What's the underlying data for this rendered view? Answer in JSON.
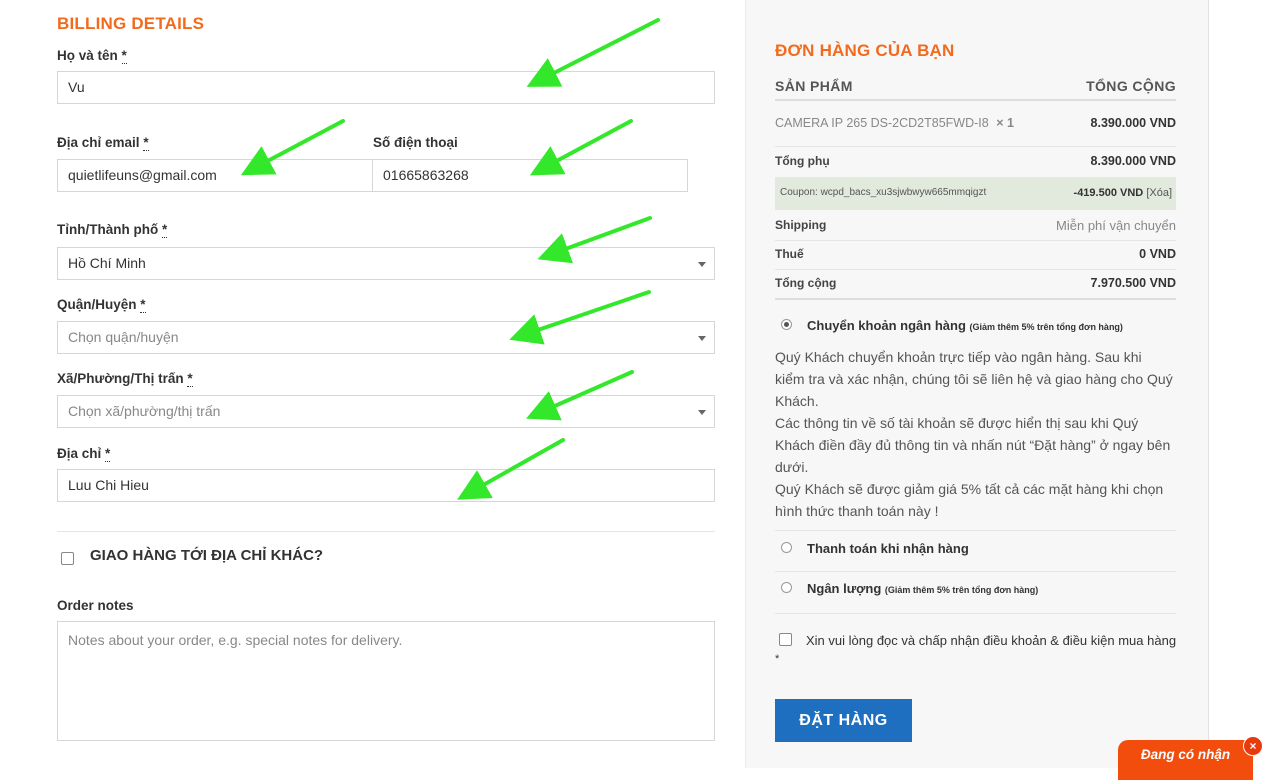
{
  "billing": {
    "title": "BILLING DETAILS",
    "fullname_label": "Họ và tên",
    "fullname_value": "Vu",
    "email_label": "Địa chỉ email",
    "email_value": "quietlifeuns@gmail.com",
    "phone_label": "Số điện thoại",
    "phone_value": "01665863268",
    "province_label": "Tỉnh/Thành phố",
    "province_value": "Hồ Chí Minh",
    "district_label": "Quận/Huyện",
    "district_placeholder": "Chọn quận/huyện",
    "ward_label": "Xã/Phường/Thị trấn",
    "ward_placeholder": "Chọn xã/phường/thị trấn",
    "address_label": "Địa chỉ",
    "address_value": "Luu Chi Hieu",
    "required_mark": "*",
    "ship_different_label": "GIAO HÀNG TỚI ĐỊA CHỈ KHÁC?",
    "order_notes_label": "Order notes",
    "order_notes_placeholder": "Notes about your order, e.g. special notes for delivery."
  },
  "order": {
    "title": "ĐƠN HÀNG CỦA BẠN",
    "col_product": "SẢN PHẨM",
    "col_total": "TỔNG CỘNG",
    "product_name": "CAMERA IP 265 DS-2CD2T85FWD-I8",
    "product_qty": "× 1",
    "product_price": "8.390.000 VND",
    "subtotal_label": "Tổng phụ",
    "subtotal_value": "8.390.000 VND",
    "coupon_label": "Coupon: wcpd_bacs_xu3sjwbwyw665mmqigzt",
    "coupon_value": "-419.500 VND",
    "coupon_remove": "[Xóa]",
    "shipping_label": "Shipping",
    "shipping_value": "Miễn phí vận chuyển",
    "tax_label": "Thuế",
    "tax_value": "0 VND",
    "total_label": "Tổng cộng",
    "total_value": "7.970.500 VND"
  },
  "payment": {
    "bank_label": "Chuyển khoản ngân hàng",
    "bank_note": "(Giảm thêm 5% trên tổng đơn hàng)",
    "bank_desc_1": "Quý Khách chuyển khoản trực tiếp vào ngân hàng. Sau khi kiểm tra và xác nhận, chúng tôi sẽ liên hệ và giao hàng cho Quý Khách.",
    "bank_desc_2": "Các thông tin về số tài khoản sẽ được hiển thị sau khi Quý Khách điền đầy đủ thông tin và nhấn nút “Đặt hàng” ở ngay bên dưới.",
    "bank_desc_3": "Quý Khách sẽ được giảm giá 5% tất cả các mặt hàng khi chọn hình thức thanh toán này !",
    "cod_label": "Thanh toán khi nhận hàng",
    "nganluong_label": "Ngân lượng",
    "nganluong_note": "(Giảm thêm 5% trên tổng đơn hàng)",
    "terms_label": "Xin vui lòng đọc và chấp nhận điều khoản & điều kiện mua hàng",
    "terms_required": "*",
    "place_order": "ĐẶT HÀNG"
  },
  "chat": {
    "label": "Đang có nhận",
    "close": "×"
  },
  "colors": {
    "accent": "#f26b1d",
    "button": "#1f6fc1",
    "arrow": "#33e82a",
    "coupon_bg": "#e2e9dd"
  }
}
